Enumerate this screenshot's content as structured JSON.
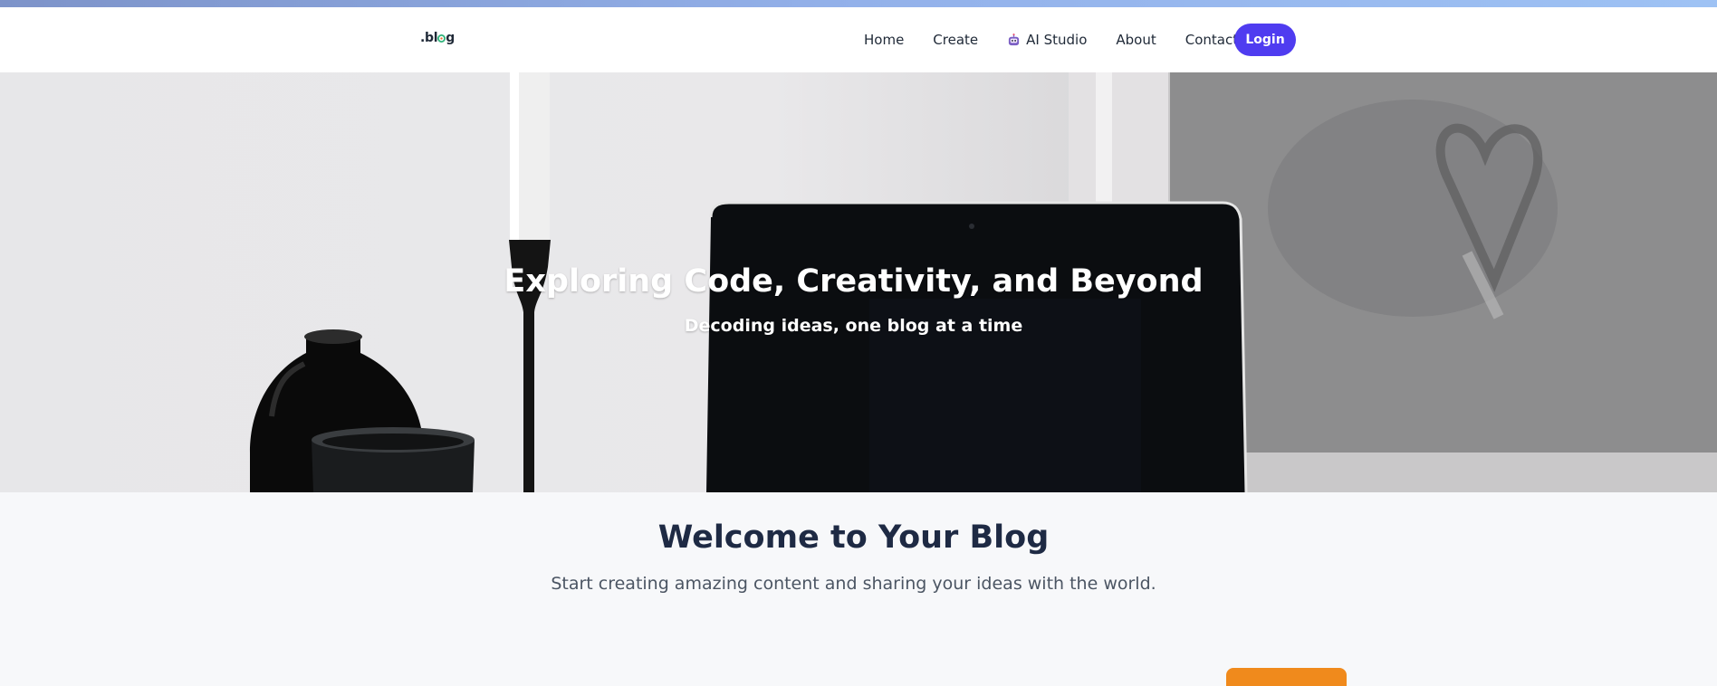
{
  "brand": {
    "prefix": ".bl",
    "suffix": "g",
    "logo_icon": "blog-logo-icon"
  },
  "nav": {
    "items": [
      {
        "label": "Home"
      },
      {
        "label": "Create"
      },
      {
        "label": "AI Studio",
        "icon": "robot-icon"
      },
      {
        "label": "About"
      },
      {
        "label": "Contact"
      }
    ],
    "login_label": "Login"
  },
  "hero": {
    "title": "Exploring Code, Creativity, and Beyond",
    "subtitle": "Decoding ideas, one blog at a time"
  },
  "welcome": {
    "title": "Welcome to Your Blog",
    "subtitle": "Start creating amazing content and sharing your ideas with the world."
  },
  "colors": {
    "accent": "#4f3cf0",
    "heading": "#1e2a44",
    "orange": "#f08a1c"
  }
}
